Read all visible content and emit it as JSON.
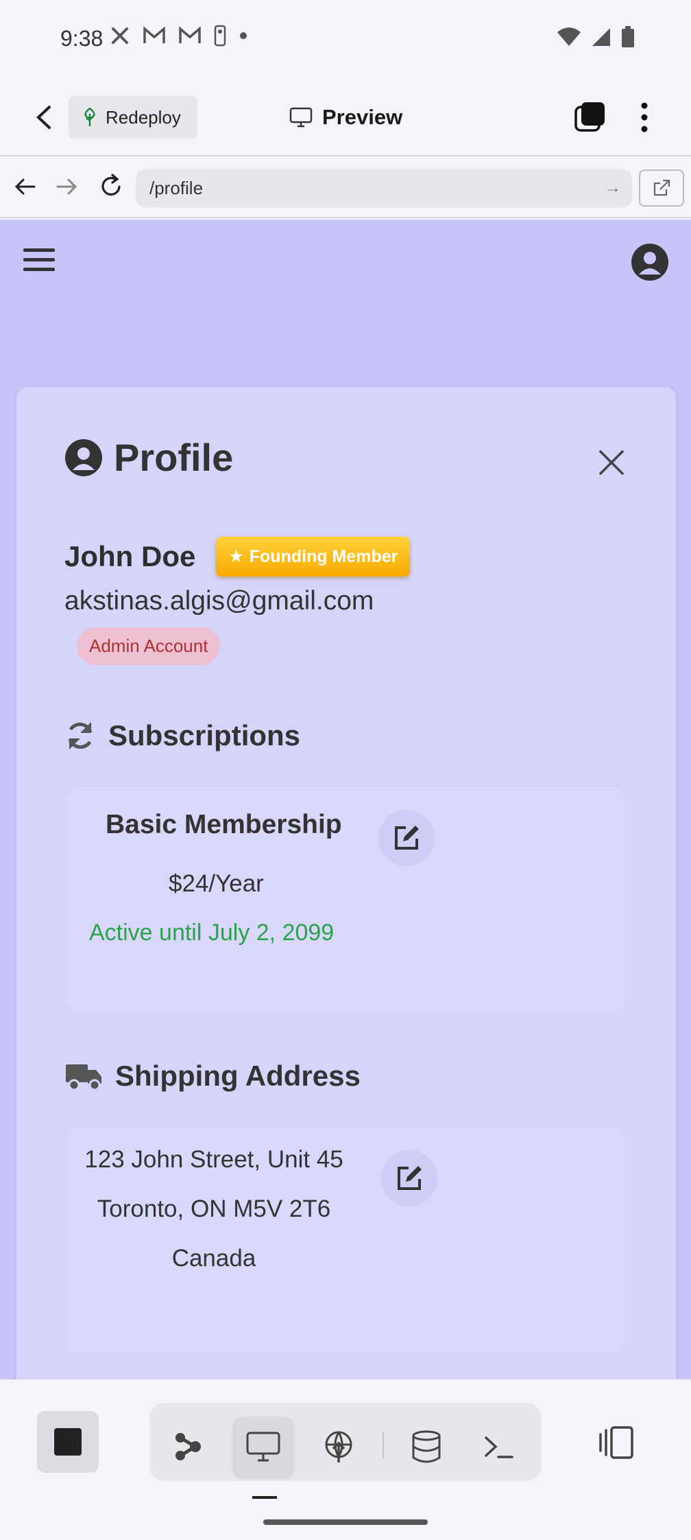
{
  "status_bar": {
    "time": "9:38",
    "notification_icons": [
      "x-icon",
      "gmail-icon",
      "gmail-icon",
      "nba-icon",
      "dot-icon"
    ],
    "right_icons": [
      "wifi-icon",
      "signal-icon",
      "battery-icon"
    ]
  },
  "app_bar": {
    "redeploy_label": "Redeploy",
    "preview_label": "Preview"
  },
  "browser": {
    "url": "/profile"
  },
  "profile": {
    "title": "Profile",
    "name": "John Doe",
    "founder_badge": "Founding Member",
    "email": "akstinas.algis@gmail.com",
    "admin_label": "Admin Account",
    "subscriptions_title": "Subscriptions",
    "subscription": {
      "plan": "Basic Membership",
      "price": "$24/Year",
      "status": "Active until July 2, 2099"
    },
    "shipping_title": "Shipping Address",
    "address": {
      "line1": "123 John Street, Unit 45",
      "line2": "Toronto, ON M5V 2T6",
      "line3": "Canada"
    }
  },
  "colors": {
    "page_bg": "#c8c5fb",
    "card_bg": "#d5d4fb",
    "accent_green": "#2ba34a",
    "founder_gold": "#f7a900",
    "admin_red": "#b03030"
  }
}
